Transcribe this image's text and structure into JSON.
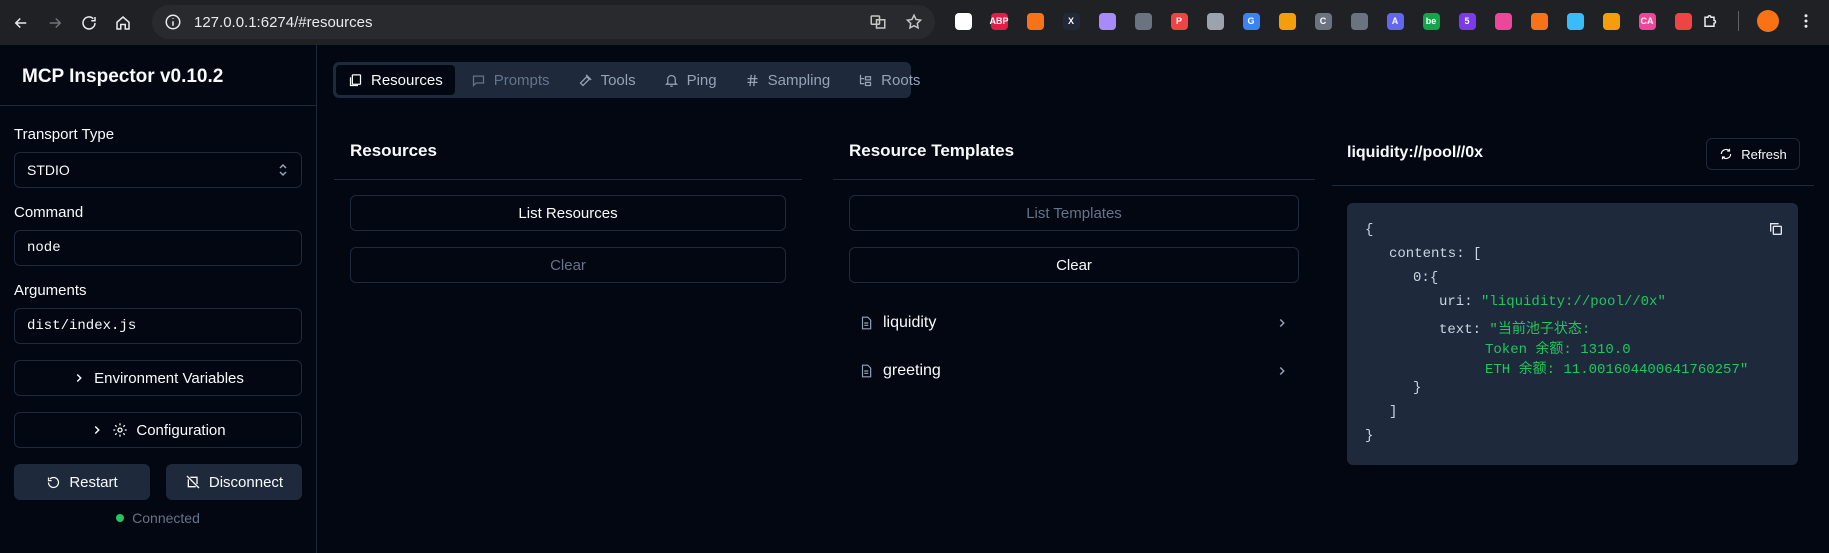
{
  "browser": {
    "url": "127.0.0.1:6274/#resources",
    "extensions": [
      {
        "icon": "circle-ext-icon",
        "text": "",
        "color": "#ffffff"
      },
      {
        "icon": "abp-ext-icon",
        "text": "ABP",
        "color": "#e11d48"
      },
      {
        "icon": "fox-ext-icon",
        "text": "",
        "color": "#f97316"
      },
      {
        "icon": "x-ext-icon",
        "text": "X",
        "color": "#1f2937"
      },
      {
        "icon": "wave-ext-icon",
        "text": "",
        "color": "#a78bfa"
      },
      {
        "icon": "grid-ext-icon",
        "text": "",
        "color": "#6b7280"
      },
      {
        "icon": "pocket-ext-icon",
        "text": "P",
        "color": "#ef4444"
      },
      {
        "icon": "camera-ext-icon",
        "text": "",
        "color": "#9ca3af"
      },
      {
        "icon": "translate-ext-icon",
        "text": "G",
        "color": "#3b82f6"
      },
      {
        "icon": "burst-ext-icon",
        "text": "",
        "color": "#f59e0b"
      },
      {
        "icon": "cc-ext-icon",
        "text": "C",
        "color": "#6b7280"
      },
      {
        "icon": "copy-ext-icon",
        "text": "",
        "color": "#6b7280"
      },
      {
        "icon": "a-ext-icon",
        "text": "A",
        "color": "#6366f1"
      },
      {
        "icon": "bee-ext-icon",
        "text": "be",
        "color": "#16a34a"
      },
      {
        "icon": "puzzle-5-ext-icon",
        "text": "5",
        "color": "#7c3aed"
      },
      {
        "icon": "frame-ext-icon",
        "text": "",
        "color": "#ec4899"
      },
      {
        "icon": "mountain-ext-icon",
        "text": "",
        "color": "#f97316"
      },
      {
        "icon": "react-ext-icon",
        "text": "",
        "color": "#38bdf8"
      },
      {
        "icon": "coin-ext-icon",
        "text": "",
        "color": "#f59e0b"
      },
      {
        "icon": "ca-ext-icon",
        "text": "CA",
        "color": "#ec4899"
      },
      {
        "icon": "key-ext-icon",
        "text": "",
        "color": "#ef4444"
      }
    ]
  },
  "sidebar": {
    "title": "MCP Inspector v0.10.2",
    "transport_label": "Transport Type",
    "transport_value": "STDIO",
    "command_label": "Command",
    "command_value": "node",
    "arguments_label": "Arguments",
    "arguments_value": "dist/index.js",
    "env_label": "Environment Variables",
    "config_label": "Configuration",
    "restart_label": "Restart",
    "disconnect_label": "Disconnect",
    "status_text": "Connected"
  },
  "tabs": [
    {
      "label": "Resources",
      "state": "active"
    },
    {
      "label": "Prompts",
      "state": "disabled"
    },
    {
      "label": "Tools",
      "state": "normal"
    },
    {
      "label": "Ping",
      "state": "normal"
    },
    {
      "label": "Sampling",
      "state": "normal"
    },
    {
      "label": "Roots",
      "state": "normal"
    }
  ],
  "resources": {
    "title": "Resources",
    "list_label": "List Resources",
    "clear_label": "Clear"
  },
  "templates": {
    "title": "Resource Templates",
    "list_label": "List Templates",
    "clear_label": "Clear",
    "items": [
      "liquidity",
      "greeting"
    ]
  },
  "result": {
    "title": "liquidity://pool//0x",
    "refresh_label": "Refresh",
    "json": {
      "open": "{",
      "contents_key": "contents:",
      "contents_open": "[",
      "idx_key": "0:",
      "idx_open": "{",
      "uri_key": "uri:",
      "uri_val": "\"liquidity://pool//0x\"",
      "text_key": "text:",
      "text_line1": "\"当前池子状态:",
      "text_line2": "Token 余额: 1310.0",
      "text_line3": "ETH 余额: 11.001604400641760257\"",
      "idx_close": "}",
      "contents_close": "]",
      "close": "}"
    }
  }
}
